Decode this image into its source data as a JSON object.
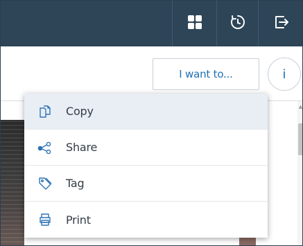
{
  "header": {
    "apps_icon": "grid-apps-icon",
    "history_icon": "history-icon",
    "logout_icon": "sign-out-icon"
  },
  "toolbar": {
    "i_want_to_label": "I want to...",
    "info_label": "i"
  },
  "menu": {
    "items": [
      {
        "label": "Copy",
        "icon": "copy-icon",
        "active": true
      },
      {
        "label": "Share",
        "icon": "share-icon",
        "active": false
      },
      {
        "label": "Tag",
        "icon": "tag-icon",
        "active": false
      },
      {
        "label": "Print",
        "icon": "print-icon",
        "active": false
      }
    ]
  },
  "colors": {
    "header_bg": "#2d4557",
    "accent_blue": "#1f6fb2",
    "menu_active_bg": "#e9eef4"
  }
}
